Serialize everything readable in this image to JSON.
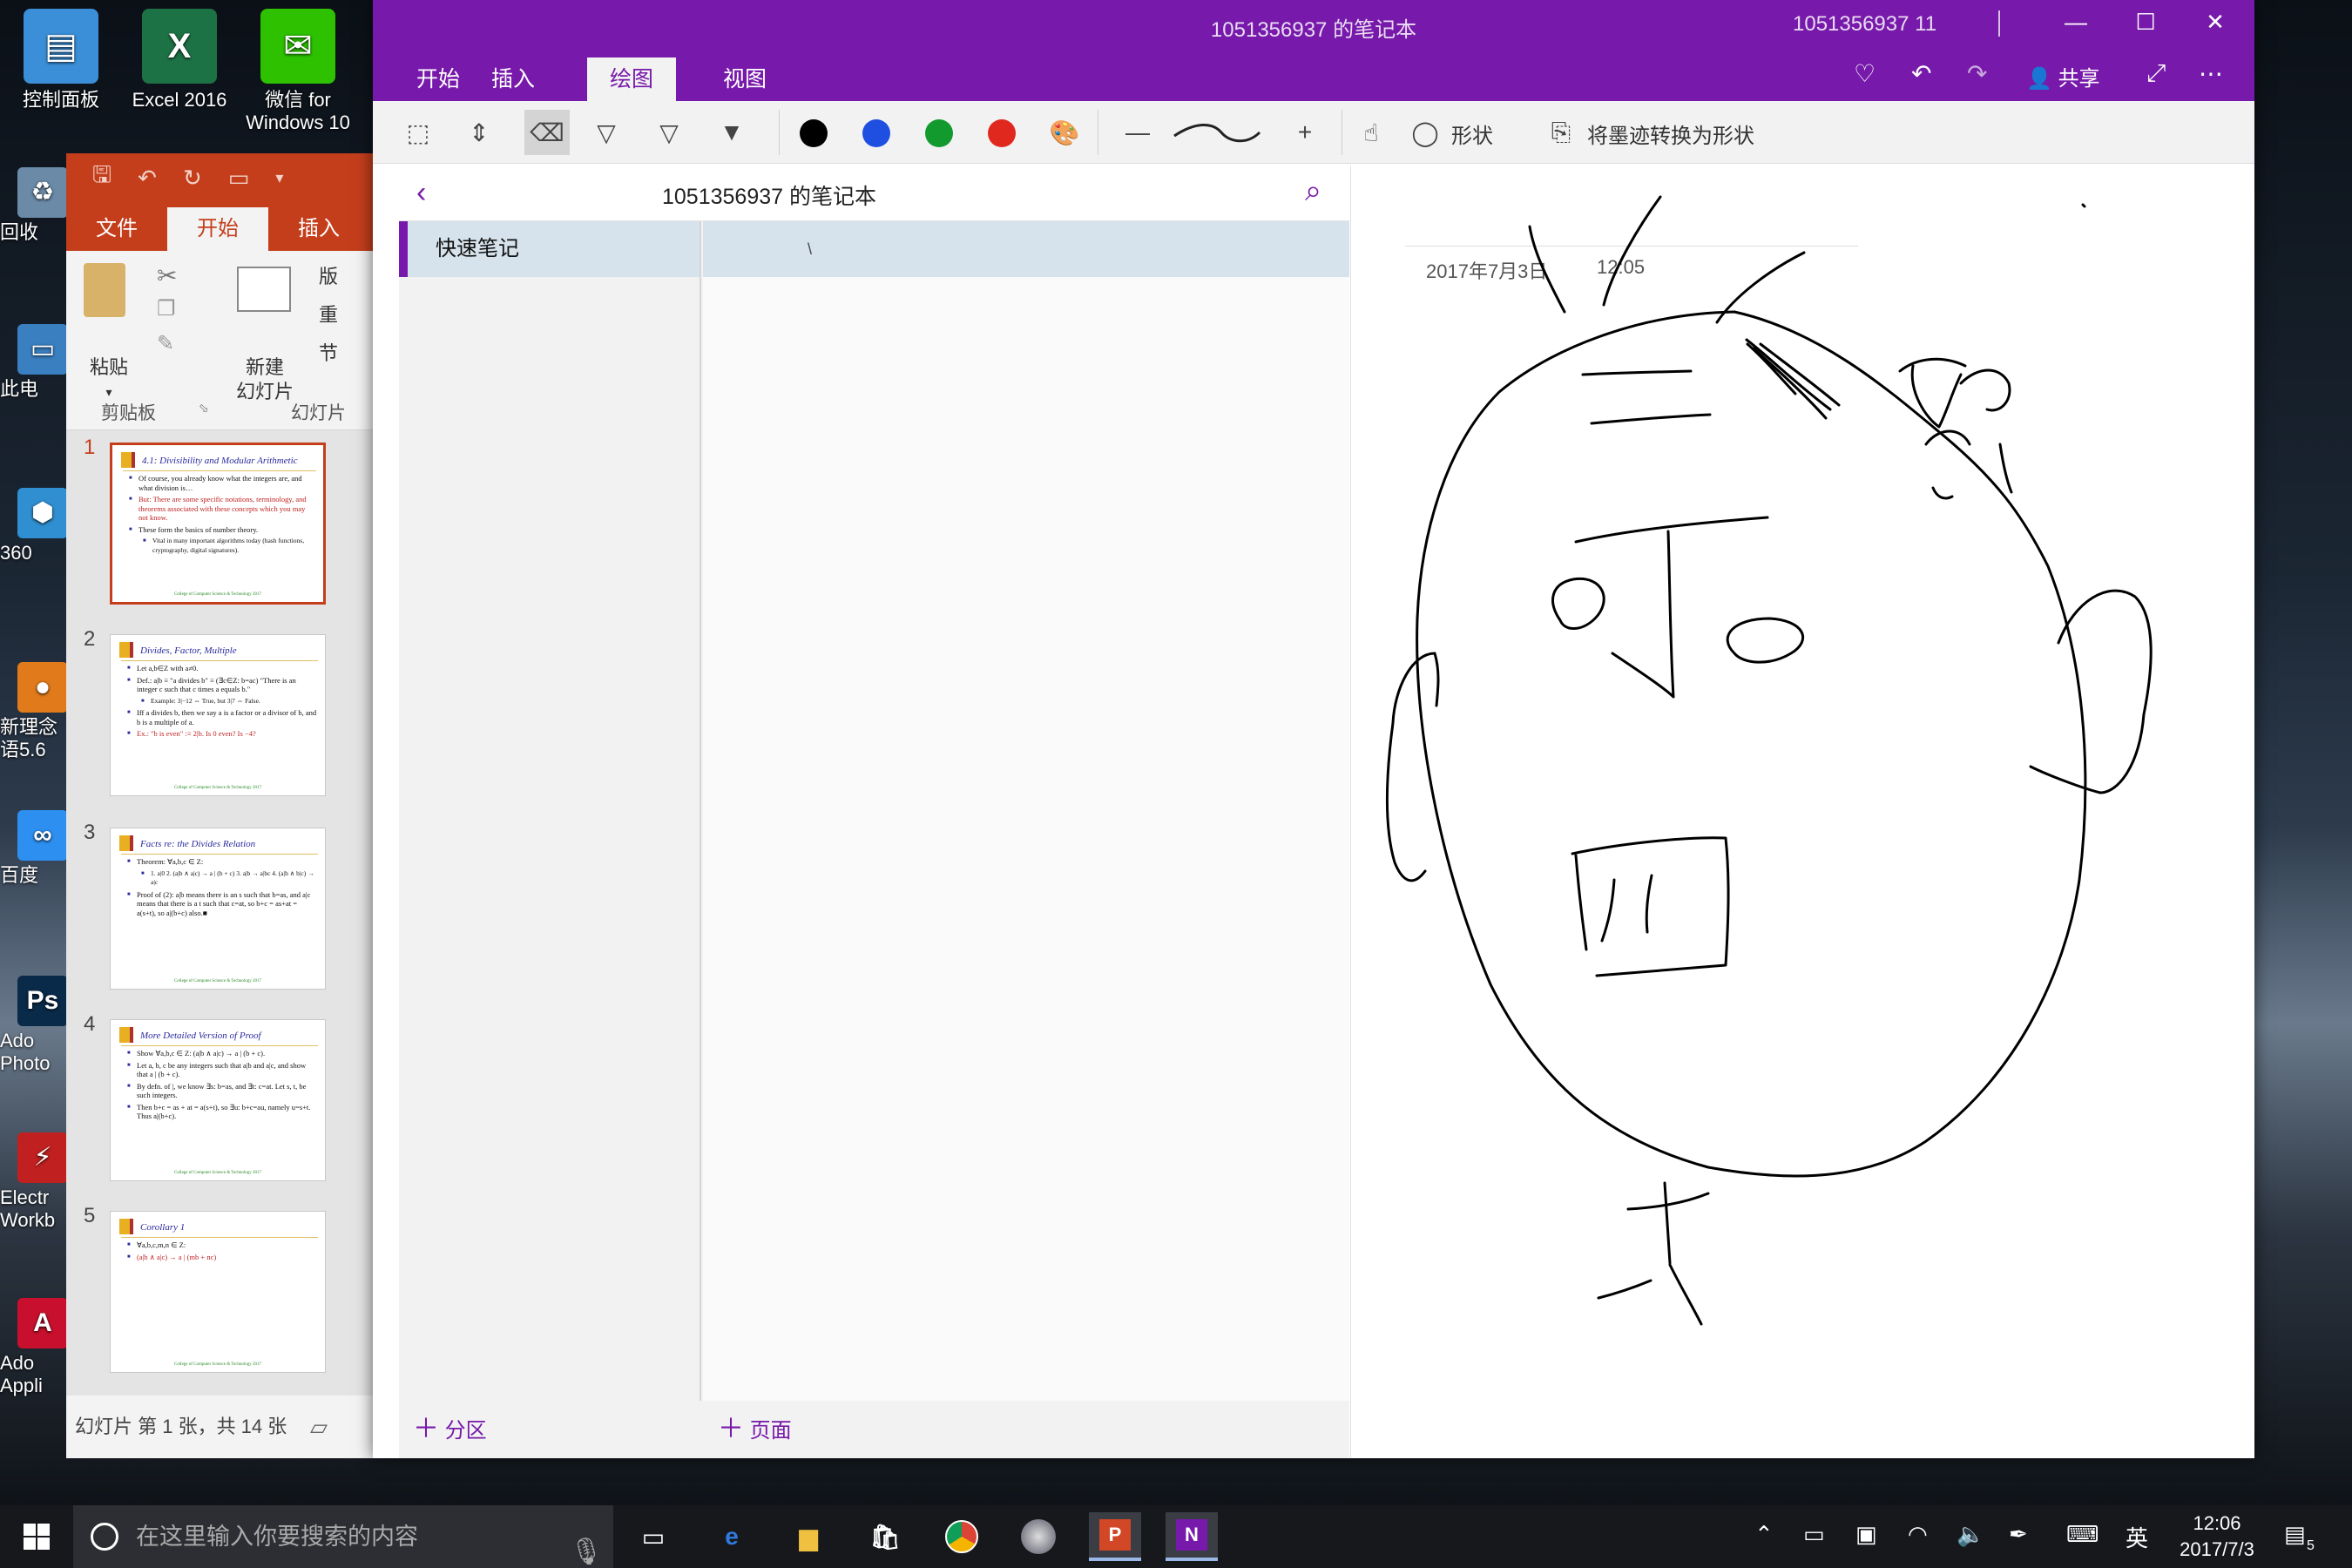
{
  "desktop": {
    "icons": [
      {
        "label": "控制面板",
        "glyph": "▤",
        "bg": "#3a8fd8"
      },
      {
        "label": "Excel 2016",
        "glyph": "X",
        "bg": "#1d7245"
      },
      {
        "label": "微信 for Windows 10",
        "glyph": "✉",
        "bg": "#2dc100"
      }
    ],
    "left_icons": [
      {
        "label": "回收",
        "glyph": "♻",
        "bg": "#6a8aa8"
      },
      {
        "label": "此电",
        "glyph": "▭",
        "bg": "#3a7fc0"
      },
      {
        "label": "360",
        "glyph": "⬢",
        "bg": "#2f8fd0"
      },
      {
        "label": "新理念\n语5.6",
        "glyph": "●",
        "bg": "#e07a1a"
      },
      {
        "label": "百度",
        "glyph": "∞",
        "bg": "#2d8ff0"
      },
      {
        "label": "Ado\nPhoto",
        "glyph": "Ps",
        "bg": "#0a2a4a"
      },
      {
        "label": "Electr\nWorkb",
        "glyph": "⚡",
        "bg": "#c02020"
      },
      {
        "label": "Ado\nAppli",
        "glyph": "A",
        "bg": "#c8102e"
      }
    ]
  },
  "powerpoint": {
    "tabs": [
      "文件",
      "开始",
      "插入"
    ],
    "active_tab": "开始",
    "ribbon": {
      "paste": "粘贴",
      "new_slide_1": "新建",
      "new_slide_2": "幻灯片",
      "clipboard_group": "剪贴板",
      "slides_group": "幻灯片",
      "side": [
        "版",
        "重",
        "节"
      ]
    },
    "slides": [
      {
        "num": "1",
        "title": "4.1: Divisibility and Modular Arithmetic",
        "bullets": [
          {
            "t": "Of course, you already know what the integers are, and what division is…",
            "c": ""
          },
          {
            "t": "But: There are some specific notations, terminology, and theorems associated with these concepts which you may not know.",
            "c": "red"
          },
          {
            "t": "These form the basics of number theory.",
            "c": ""
          },
          {
            "t": "Vital in many important algorithms today (hash functions, cryptography, digital signatures).",
            "c": "sub"
          }
        ]
      },
      {
        "num": "2",
        "title": "Divides, Factor, Multiple",
        "bullets": [
          {
            "t": "Let a,b∈Z with a≠0.",
            "c": ""
          },
          {
            "t": "Def.: a|b ≡ \"a divides b\" ≡ (∃c∈Z: b=ac) \"There is an integer c such that c times a equals b.\"",
            "c": ""
          },
          {
            "t": "Example: 3|−12 ⇔ True, but 3|7 ⇔ False.",
            "c": "sub"
          },
          {
            "t": "Iff a divides b, then we say a is a factor or a divisor of b, and b is a multiple of a.",
            "c": ""
          },
          {
            "t": "Ex.: \"b is even\" :≡ 2|b. Is 0 even? Is −4?",
            "c": "red"
          }
        ]
      },
      {
        "num": "3",
        "title": "Facts re: the Divides Relation",
        "bullets": [
          {
            "t": "Theorem: ∀a,b,c ∈ Z:",
            "c": ""
          },
          {
            "t": "1. a|0   2. (a|b ∧ a|c) → a | (b + c)   3. a|b → a|bc   4. (a|b ∧ b|c) → a|c",
            "c": "sub"
          },
          {
            "t": "Proof of (2): a|b means there is an s such that b=as, and a|c means that there is a t such that c=at, so b+c = as+at = a(s+t), so a|(b+c) also.■",
            "c": ""
          }
        ]
      },
      {
        "num": "4",
        "title": "More Detailed Version of Proof",
        "bullets": [
          {
            "t": "Show ∀a,b,c ∈ Z: (a|b ∧ a|c) → a | (b + c).",
            "c": ""
          },
          {
            "t": "Let a, b, c be any integers such that a|b and a|c, and show that a | (b + c).",
            "c": ""
          },
          {
            "t": "By defn. of |, we know ∃s: b=as, and ∃t: c=at. Let s, t, be such integers.",
            "c": ""
          },
          {
            "t": "Then b+c = as + at = a(s+t), so ∃u: b+c=au, namely u=s+t. Thus a|(b+c).",
            "c": ""
          }
        ]
      },
      {
        "num": "5",
        "title": "Corollary 1",
        "bullets": [
          {
            "t": "∀a,b,c,m,n ∈ Z:",
            "c": ""
          },
          {
            "t": "(a|b ∧ a|c) → a | (mb + nc)",
            "c": "red"
          }
        ]
      }
    ],
    "slide_footer": "College of Computer Science & Technology 2017",
    "status": "幻灯片 第 1 张，共 14 张"
  },
  "onenote": {
    "window_title": "1051356937 的笔记本",
    "user": "1051356937 11",
    "tabs": [
      "开始",
      "插入",
      "绘图",
      "视图"
    ],
    "active_tab": "绘图",
    "share": "共享",
    "tools": {
      "shapes": "形状",
      "ink_to_shape": "将墨迹转换为形状"
    },
    "pen_colors": [
      "#000000",
      "#1f4fe0",
      "#139a2f",
      "#e0281e"
    ],
    "notebook_name": "1051356937 的笔记本",
    "section": "快速笔记",
    "page_title": "\\",
    "add_section": "分区",
    "add_page": "页面",
    "date": "2017年7月3日",
    "time": "12:05"
  },
  "taskbar": {
    "search_placeholder": "在这里输入你要搜索的内容",
    "ime": "英",
    "clock_time": "12:06",
    "clock_date": "2017/7/3",
    "notification_count": "5"
  }
}
